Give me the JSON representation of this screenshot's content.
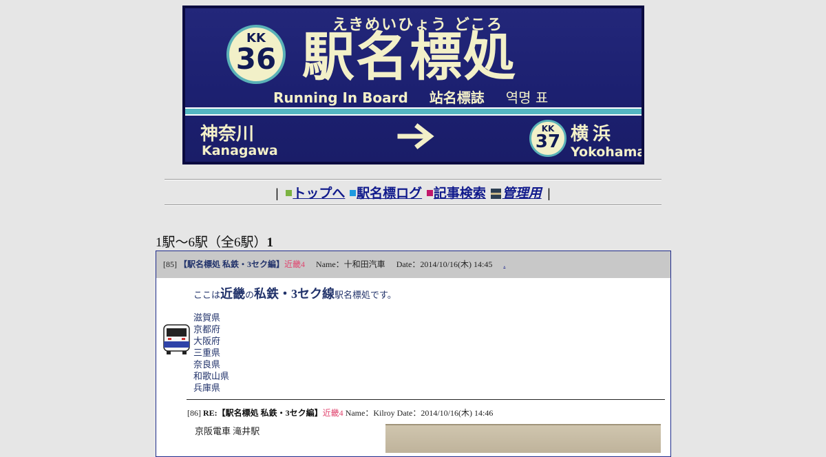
{
  "banner": {
    "furigana": "えきめいひょう どころ",
    "title": "駅名標処",
    "station_number": {
      "line": "KK",
      "num": "36"
    },
    "subtitle_en": "Running In Board",
    "subtitle_cn": "站名標誌",
    "subtitle_kr": "역명 표",
    "prev": {
      "ja": "神奈川",
      "en": "Kanagawa"
    },
    "next": {
      "ja": "横浜",
      "en": "Yokohama",
      "line": "KK",
      "num": "37"
    },
    "colors": {
      "board": "#1c2070",
      "text": "#f3f0c8",
      "stripe": "#54b6c2"
    }
  },
  "nav": {
    "items": [
      {
        "label": "トップへ",
        "color": "#7cb342"
      },
      {
        "label": "駅名標ログ",
        "color": "#1e9be0"
      },
      {
        "label": "記事検索",
        "color": "#c2186b"
      },
      {
        "label": "管理用",
        "icon": "train-icon"
      }
    ],
    "separator": "|"
  },
  "count": {
    "text": "1駅～6駅（全6駅）",
    "page": "1"
  },
  "post": {
    "id": "[85]",
    "title": "【駅名標処 私鉄・3セク編】",
    "region": "近畿4",
    "name": "Name：十和田汽車",
    "date": "Date：2014/10/16(木) 14:45",
    "link": ".",
    "body_pre": "ここは",
    "body_em1": "近畿",
    "body_mid": "の",
    "body_em2": "私鉄・3セク線",
    "body_post": "駅名標処です。",
    "prefectures": [
      "滋賀県",
      "京都府",
      "大阪府",
      "三重県",
      "奈良県",
      "和歌山県",
      "兵庫県"
    ]
  },
  "reply": {
    "id": "[86]",
    "title": "RE:【駅名標処 私鉄・3セク編】",
    "region": "近畿4",
    "name": "Name：Kilroy",
    "date": "Date：2014/10/16(木) 14:46",
    "body": "京阪電車 滝井駅"
  }
}
